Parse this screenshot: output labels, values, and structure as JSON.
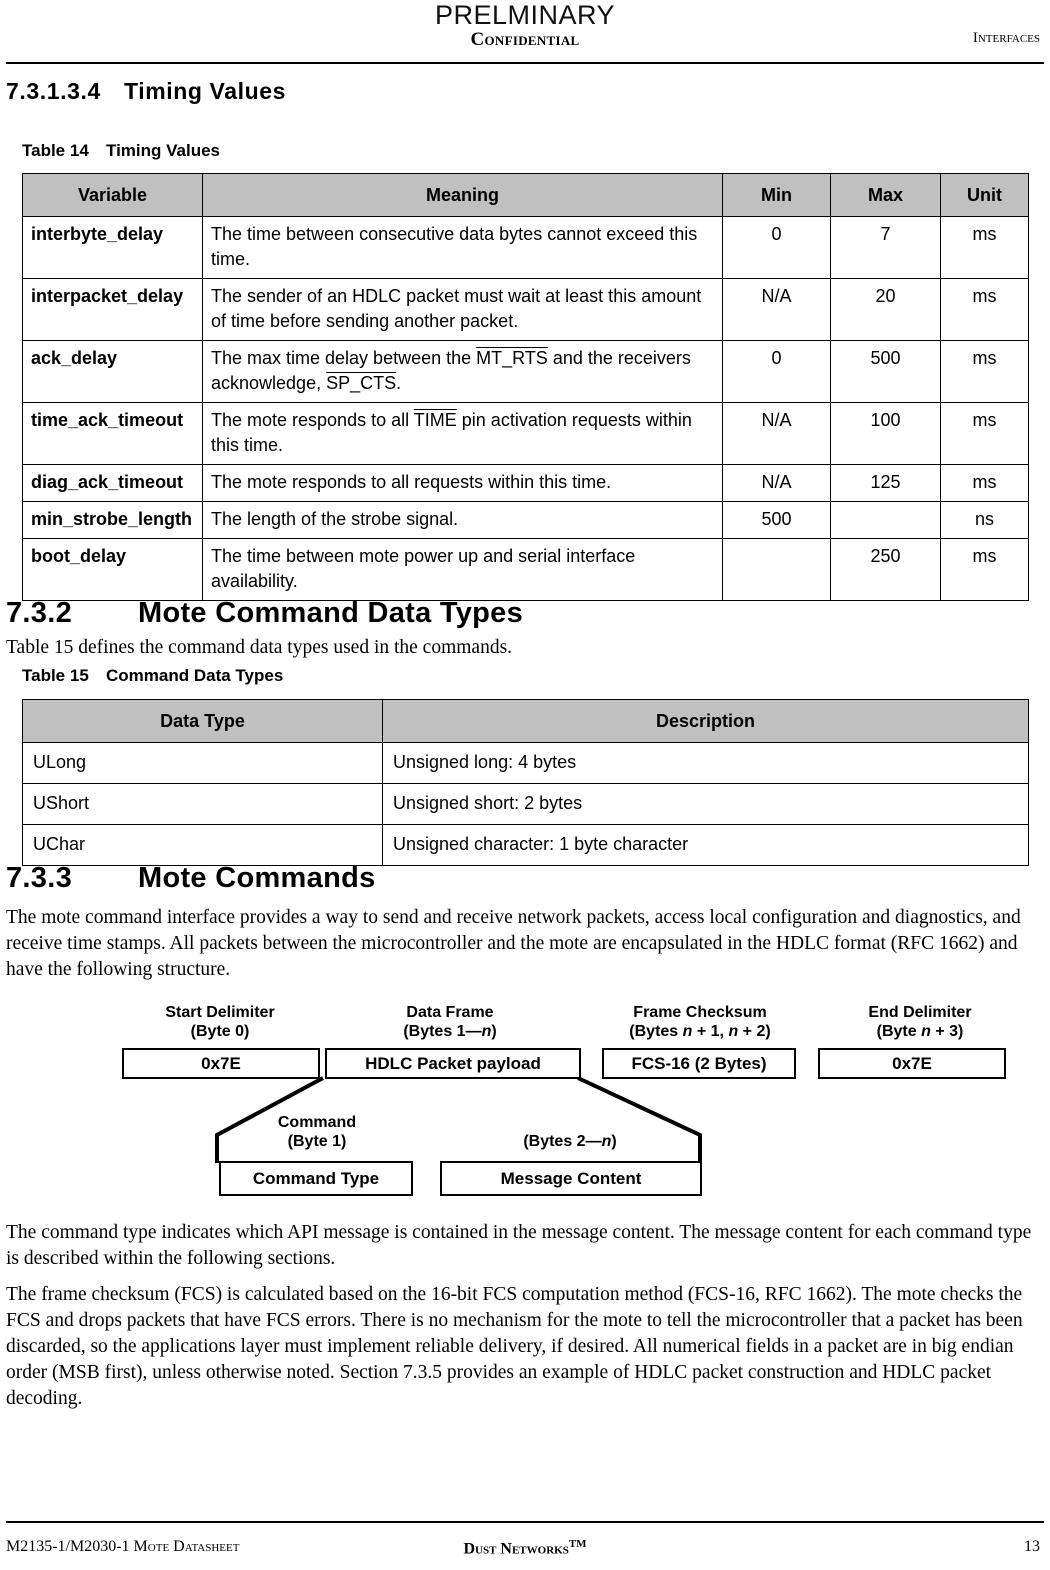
{
  "header": {
    "preliminary": "PRELMINARY",
    "confidential": "Confidential",
    "section_name": "Interfaces"
  },
  "section_7313_4": {
    "number": "7.3.1.3.4",
    "title": "Timing Values"
  },
  "table14": {
    "caption_number": "Table 14",
    "caption_title": "Timing Values",
    "columns": [
      "Variable",
      "Meaning",
      "Min",
      "Max",
      "Unit"
    ],
    "rows": [
      {
        "variable": "interbyte_delay",
        "meaning": "The time between consecutive data bytes cannot exceed this time.",
        "min": "0",
        "max": "7",
        "unit": "ms"
      },
      {
        "variable": "interpacket_delay",
        "meaning": "The sender of an HDLC packet must wait at least this amount of time before sending another packet.",
        "min": "N/A",
        "max": "20",
        "unit": "ms"
      },
      {
        "variable": "ack_delay",
        "meaning_pre": "The max time delay between the ",
        "meaning_sig1": "MT_RTS",
        "meaning_mid": " and the receivers acknowledge, ",
        "meaning_sig2": "SP_CTS",
        "meaning_post": ".",
        "min": "0",
        "max": "500",
        "unit": "ms"
      },
      {
        "variable": "time_ack_timeout",
        "meaning_pre": "The mote responds to all ",
        "meaning_sig1": "TIME",
        "meaning_post": " pin activation requests within this time.",
        "min": "N/A",
        "max": "100",
        "unit": "ms"
      },
      {
        "variable": "diag_ack_timeout",
        "meaning": "The mote responds to all requests within this time.",
        "min": "N/A",
        "max": "125",
        "unit": "ms"
      },
      {
        "variable": "min_strobe_length",
        "meaning": "The length of the strobe signal.",
        "min": "500",
        "max": "",
        "unit": "ns"
      },
      {
        "variable": "boot_delay",
        "meaning": "The time between mote power up and serial interface availability.",
        "min": "",
        "max": "250",
        "unit": "ms"
      }
    ]
  },
  "section_732": {
    "number": "7.3.2",
    "title": "Mote Command Data Types",
    "intro": "Table 15 defines the command data types used in the commands."
  },
  "table15": {
    "caption_number": "Table 15",
    "caption_title": "Command Data Types",
    "columns": [
      "Data Type",
      "Description"
    ],
    "rows": [
      {
        "data_type": "ULong",
        "description": "Unsigned long: 4 bytes"
      },
      {
        "data_type": "UShort",
        "description": "Unsigned short: 2 bytes"
      },
      {
        "data_type": "UChar",
        "description": "Unsigned character: 1 byte character"
      }
    ]
  },
  "section_733": {
    "number": "7.3.3",
    "title": "Mote Commands",
    "paragraph1": "The mote command interface provides a way to send and receive network packets, access local configuration and diagnostics, and receive time stamps. All packets between the microcontroller and the mote are encapsulated in the HDLC format (RFC 1662) and have the following structure.",
    "paragraph2": "The command type indicates which API message is contained in the message content. The message content for each command type is described within the following sections.",
    "paragraph3": "The frame checksum (FCS) is calculated based on the 16-bit FCS computation method (FCS-16, RFC 1662). The mote checks the FCS and drops packets that have FCS errors. There is no mechanism for the mote to tell the microcontroller that a packet has been discarded, so the applications layer must implement reliable delivery, if desired. All numerical fields in a packet are in big endian order (MSB first), unless otherwise noted. Section 7.3.5 provides an example of HDLC packet construction and HDLC packet decoding."
  },
  "hdlc_diagram": {
    "fields": [
      {
        "label": "Start Delimiter",
        "range_pre": "(Byte 0",
        "range_ital": "",
        "range_post": ")",
        "box": "0x7E"
      },
      {
        "label": "Data Frame",
        "range_pre": "(Bytes 1—",
        "range_ital": "n",
        "range_post": ")",
        "box": "HDLC Packet payload"
      },
      {
        "label": "Frame Checksum",
        "range_pre": "(Bytes ",
        "range_ital": "n",
        "range_mid": " + 1, ",
        "range_ital2": "n",
        "range_post": " + 2)",
        "box": "FCS-16 (2 Bytes)"
      },
      {
        "label": "End Delimiter",
        "range_pre": "(Byte ",
        "range_ital": "n",
        "range_post": " + 3)",
        "box": "0x7E"
      }
    ],
    "subfields": [
      {
        "label": "Command",
        "range_pre": "(Byte 1",
        "range_ital": "",
        "range_post": ")",
        "box": "Command Type"
      },
      {
        "label": "",
        "range_pre": "(Bytes 2—",
        "range_ital": "n",
        "range_post": ")",
        "box": "Message Content"
      }
    ]
  },
  "footer": {
    "left": "M2135-1/M2030-1 Mote Datasheet",
    "center": "Dust Networks",
    "center_tm": "TM",
    "page": "13"
  }
}
